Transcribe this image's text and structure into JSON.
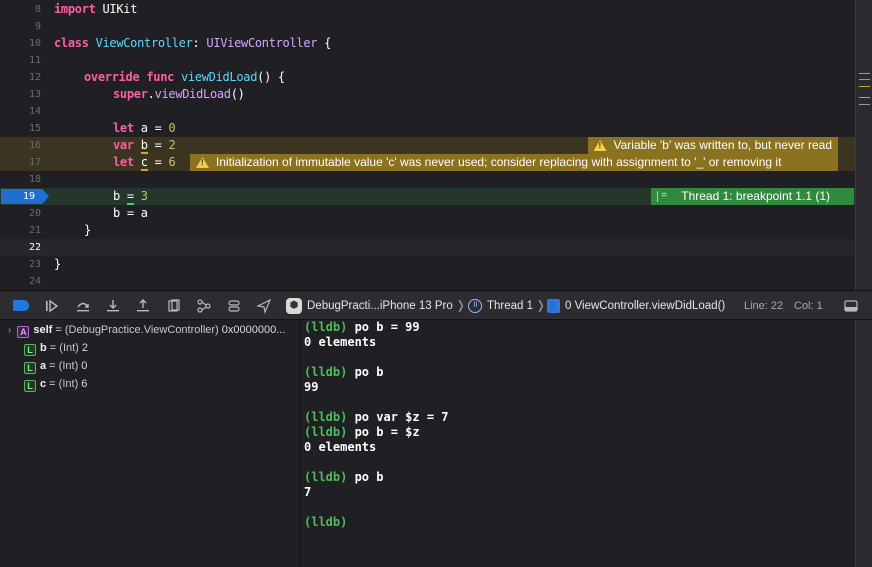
{
  "editor": {
    "lines": [
      {
        "n": "8"
      },
      {
        "n": "9"
      },
      {
        "n": "10"
      },
      {
        "n": "11"
      },
      {
        "n": "12"
      },
      {
        "n": "13"
      },
      {
        "n": "14"
      },
      {
        "n": "15"
      },
      {
        "n": "16"
      },
      {
        "n": "17"
      },
      {
        "n": "18"
      },
      {
        "n": "19"
      },
      {
        "n": "20"
      },
      {
        "n": "21"
      },
      {
        "n": "22"
      },
      {
        "n": "23"
      },
      {
        "n": "24"
      }
    ],
    "warning_b": "Variable 'b' was written to, but never read",
    "warning_c": "Initialization of immutable value 'c' was never used; consider replacing with assignment to '_' or removing it",
    "breakpoint_label": "Thread 1: breakpoint 1.1 (1)",
    "breakpoint_line": "19"
  },
  "debugbar": {
    "scheme": "DebugPracti...iPhone 13 Pro",
    "thread": "Thread 1",
    "frame": "0 ViewController.viewDidLoad()",
    "line_label": "Line: 22",
    "col_label": "Col: 1",
    "sep": "❭"
  },
  "variables": [
    {
      "badge": "A",
      "name": "self",
      "type": "(DebugPractice.ViewController)",
      "value": "0x0000000..."
    },
    {
      "badge": "L",
      "name": "b",
      "type": "(Int)",
      "value": "2"
    },
    {
      "badge": "L",
      "name": "a",
      "type": "(Int)",
      "value": "0"
    },
    {
      "badge": "L",
      "name": "c",
      "type": "(Int)",
      "value": "6"
    }
  ],
  "console": {
    "prompt": "(lldb)",
    "lines": [
      {
        "prompt": true,
        "text": " po b = 99"
      },
      {
        "prompt": false,
        "text": "0 elements"
      },
      {
        "prompt": false,
        "text": ""
      },
      {
        "prompt": true,
        "text": " po b"
      },
      {
        "prompt": false,
        "text": "99"
      },
      {
        "prompt": false,
        "text": ""
      },
      {
        "prompt": true,
        "text": " po var $z = 7"
      },
      {
        "prompt": true,
        "text": " po b = $z"
      },
      {
        "prompt": false,
        "text": "0 elements"
      },
      {
        "prompt": false,
        "text": ""
      },
      {
        "prompt": true,
        "text": " po b"
      },
      {
        "prompt": false,
        "text": "7"
      },
      {
        "prompt": false,
        "text": ""
      },
      {
        "prompt": true,
        "text": ""
      }
    ]
  },
  "code_tokens": {
    "import": "import",
    "uikit": "UIKit",
    "class": "class",
    "vc": "ViewController",
    "colon": ":",
    "uivc": "UIViewController",
    "brace_open": " {",
    "override": "override",
    "func": "func",
    "vdl": "viewDidLoad",
    "parens_brace": "() {",
    "super": "super",
    "dot": ".",
    "parens": "()",
    "let": "let",
    "var": "var",
    "a": "a",
    "b": "b",
    "c": "c",
    "eq": " = ",
    "n0": "0",
    "n2": "2",
    "n6": "6",
    "n3": "3",
    "b_eq_a": "b = a",
    "brace_close": "}"
  },
  "colors": {
    "warning": "#8a7220",
    "breakpoint": "#2f8a3e",
    "prompt": "#4cbf58",
    "breakpoint_marker": "#1f6fd0"
  },
  "icons": [
    "breakpoint-toggle-icon",
    "continue-icon",
    "step-over-icon",
    "step-into-icon",
    "step-out-icon",
    "debug-view-hierarchy-icon",
    "memory-graph-icon",
    "environment-overrides-icon",
    "simulate-location-icon",
    "app-icon",
    "thread-icon",
    "frame-icon",
    "panel-toggle-icon"
  ]
}
